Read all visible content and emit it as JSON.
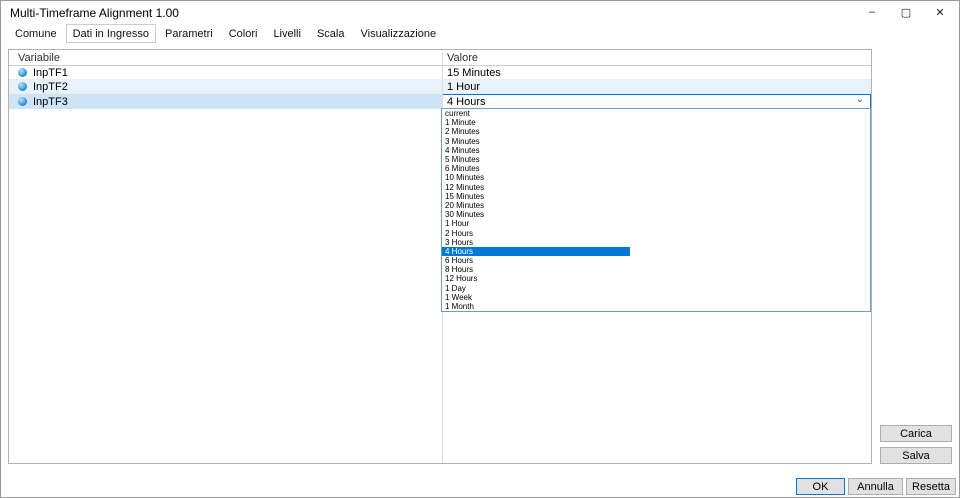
{
  "window": {
    "title": "Multi-Timeframe Alignment 1.00"
  },
  "window_controls": {
    "minimize": "–",
    "maximize": "▢",
    "close": "✕"
  },
  "tabs": [
    "Comune",
    "Dati in Ingresso",
    "Parametri",
    "Colori",
    "Livelli",
    "Scala",
    "Visualizzazione"
  ],
  "active_tab": "Dati in Ingresso",
  "table": {
    "columns": [
      "Variabile",
      "Valore"
    ],
    "rows": [
      {
        "variable": "InpTF1",
        "value": "15 Minutes",
        "state": "normal"
      },
      {
        "variable": "InpTF2",
        "value": "1 Hour",
        "state": "highlighted"
      },
      {
        "variable": "InpTF3",
        "value": "4 Hours",
        "state": "selected"
      }
    ],
    "selected_row": "InpTF3"
  },
  "dropdown": {
    "open_for": "InpTF3",
    "selected": "4 Hours",
    "options": [
      "current",
      "1 Minute",
      "2 Minutes",
      "3 Minutes",
      "4 Minutes",
      "5 Minutes",
      "6 Minutes",
      "10 Minutes",
      "12 Minutes",
      "15 Minutes",
      "20 Minutes",
      "30 Minutes",
      "1 Hour",
      "2 Hours",
      "3 Hours",
      "4 Hours",
      "6 Hours",
      "8 Hours",
      "12 Hours",
      "1 Day",
      "1 Week",
      "1 Month"
    ]
  },
  "side_buttons": {
    "load": "Carica",
    "save": "Salva"
  },
  "bottom_buttons": {
    "ok": "OK",
    "cancel": "Annulla",
    "reset": "Resetta"
  },
  "colors": {
    "accent": "#0078d7",
    "selected_row_bg": "#cde3f6",
    "highlight_row_bg": "#e7f2fb",
    "button_bg": "#e1e1e1",
    "button_border": "#adadad",
    "table_border": "#b2b2b2",
    "dropdown_border": "#6d9cc4"
  }
}
